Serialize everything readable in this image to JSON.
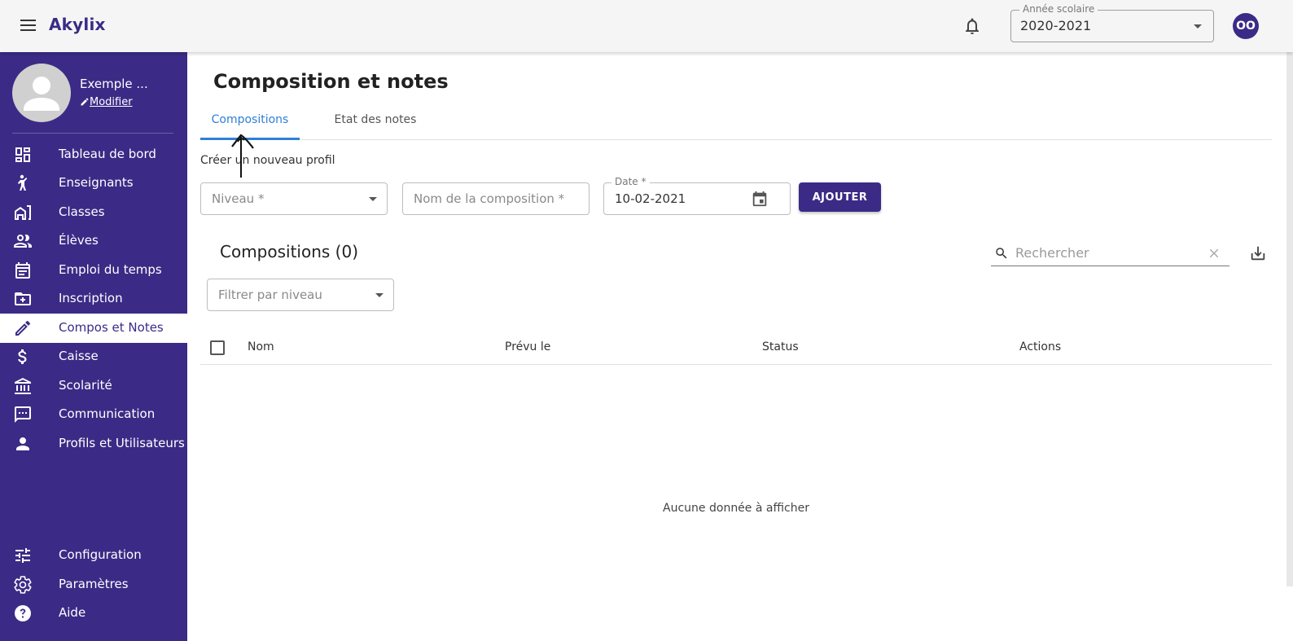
{
  "app": {
    "brand": "Akylix"
  },
  "topbar": {
    "year_label": "Année scolaire",
    "year_value": "2020-2021",
    "user_initials": "OO"
  },
  "sidebar": {
    "profile": {
      "name": "Exemple ...",
      "edit_label": "Modifier"
    },
    "items": [
      {
        "label": "Tableau de bord",
        "icon": "dashboard-icon"
      },
      {
        "label": "Enseignants",
        "icon": "teacher-icon"
      },
      {
        "label": "Classes",
        "icon": "building-icon"
      },
      {
        "label": "Élèves",
        "icon": "people-icon"
      },
      {
        "label": "Emploi du temps",
        "icon": "calendar-icon"
      },
      {
        "label": "Inscription",
        "icon": "folder-plus-icon"
      },
      {
        "label": "Compos et Notes",
        "icon": "pencil-icon",
        "active": true
      },
      {
        "label": "Caisse",
        "icon": "dollar-icon"
      },
      {
        "label": "Scolarité",
        "icon": "bank-icon"
      },
      {
        "label": "Communication",
        "icon": "chat-icon"
      },
      {
        "label": "Profils et Utilisateurs",
        "icon": "person-icon"
      }
    ],
    "bottom_items": [
      {
        "label": "Configuration",
        "icon": "sliders-icon"
      },
      {
        "label": "Paramètres",
        "icon": "gear-icon"
      },
      {
        "label": "Aide",
        "icon": "help-icon"
      }
    ]
  },
  "main": {
    "title": "Composition et notes",
    "tabs": [
      {
        "label": "Compositions",
        "active": true
      },
      {
        "label": "Etat des notes",
        "active": false
      }
    ],
    "create_label": "Créer un nouveau profil",
    "form": {
      "niveau_placeholder": "Niveau *",
      "nom_placeholder": "Nom de la composition *",
      "date_label": "Date *",
      "date_value": "10-02-2021",
      "add_button": "AJOUTER"
    },
    "list": {
      "title": "Compositions (0)",
      "search_placeholder": "Rechercher",
      "filter_placeholder": "Filtrer par niveau",
      "columns": [
        "Nom",
        "Prévu le",
        "Status",
        "Actions"
      ],
      "rows": [],
      "empty_text": "Aucune donnée à afficher"
    }
  },
  "colors": {
    "primary": "#3b2b86",
    "tab_active": "#2f7fd6"
  }
}
